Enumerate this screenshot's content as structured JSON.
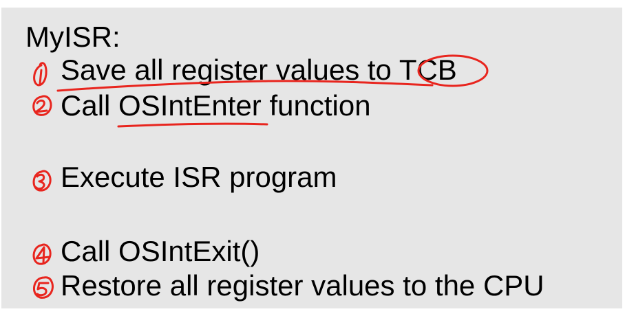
{
  "slide": {
    "title": "MyISR:",
    "steps": [
      {
        "label": "Save all register values to TCB"
      },
      {
        "label": "Call OSIntEnter function"
      },
      {
        "label": "Execute ISR program"
      },
      {
        "label": "Call OSIntExit()"
      },
      {
        "label": "Restore all register values to the CPU"
      }
    ]
  },
  "annotations": {
    "ink_color": "#e8251e",
    "handwritten_numbers": [
      "1",
      "2",
      "3",
      "4",
      "5"
    ]
  }
}
